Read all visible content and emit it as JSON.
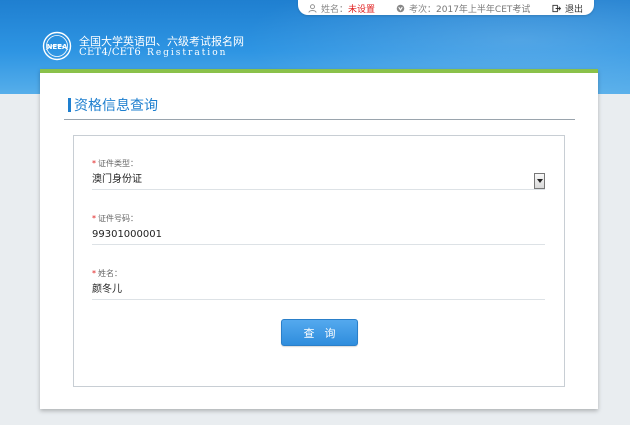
{
  "topbar": {
    "name_label": "姓名：",
    "name_value": "未设置",
    "exam_label": "考次：",
    "exam_value": "2017年上半年CET考试",
    "logout_label": "退出"
  },
  "header": {
    "title_cn": "全国大学英语四、六级考试报名网",
    "title_en": "CET4/CET6",
    "title_reg": "Registration",
    "logo_text": "NEEA"
  },
  "section": {
    "title": "资格信息查询"
  },
  "form": {
    "id_type": {
      "label": "证件类型：",
      "value": "澳门身份证"
    },
    "id_number": {
      "label": "证件号码：",
      "value": "99301000001"
    },
    "name": {
      "label": "姓名：",
      "value": "颜冬儿"
    },
    "required_mark": "*",
    "submit_label": "查询"
  },
  "colors": {
    "brand_blue": "#1e7fcf",
    "accent_green": "#8ac14a",
    "required_red": "#e02020"
  }
}
